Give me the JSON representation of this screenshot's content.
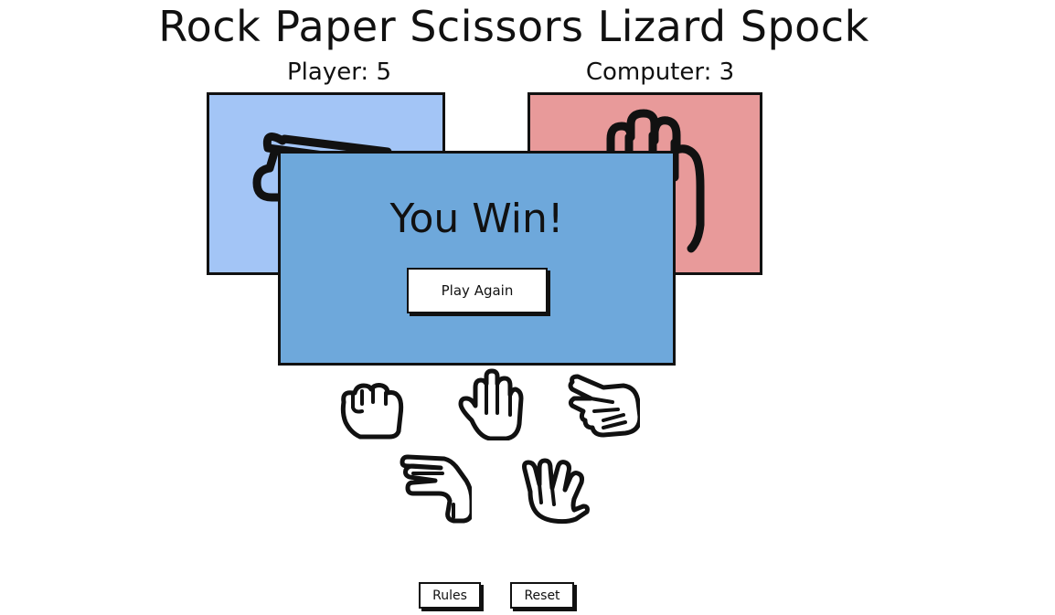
{
  "app": {
    "title": "Rock Paper Scissors Lizard Spock"
  },
  "scores": {
    "player_label": "Player: 5",
    "computer_label": "Computer: 3"
  },
  "cards": {
    "player_choice_icon": "paper-hand-icon",
    "player_color": "#a3c5f6",
    "computer_choice_icon": "paper-hand-icon",
    "computer_color": "#e89a9a"
  },
  "modal": {
    "result": "You Win!",
    "play_again_label": "Play Again",
    "background": "#6ea8db"
  },
  "choices": [
    {
      "icon": "rock-hand-icon"
    },
    {
      "icon": "paper-hand-icon"
    },
    {
      "icon": "scissors-hand-icon"
    },
    {
      "icon": "lizard-hand-icon"
    },
    {
      "icon": "spock-hand-icon"
    }
  ],
  "footer": {
    "rules_label": "Rules",
    "reset_label": "Reset"
  }
}
